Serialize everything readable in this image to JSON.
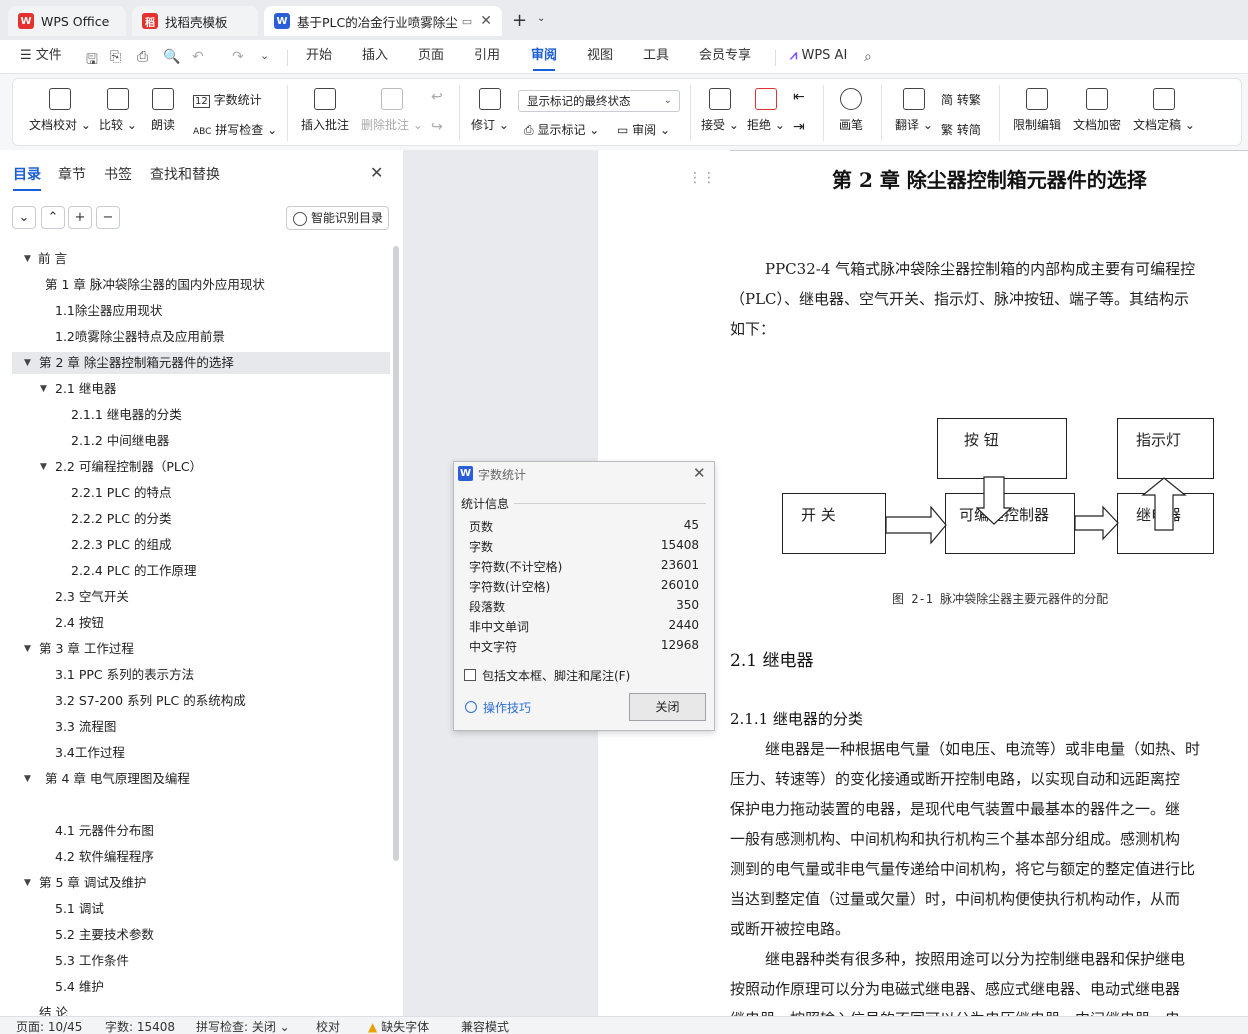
{
  "tabs": [
    {
      "label": "WPS Office"
    },
    {
      "label": "找稻壳模板"
    },
    {
      "label": "基于PLC的冶金行业喷雾除尘"
    }
  ],
  "menu": {
    "file": "文件",
    "items": [
      "开始",
      "插入",
      "页面",
      "引用",
      "审阅",
      "视图",
      "工具",
      "会员专享"
    ],
    "active": "审阅",
    "wps_ai": "WPS AI"
  },
  "ribbon": {
    "doc_check": "文档校对",
    "compare": "比较",
    "read_aloud": "朗读",
    "word_count": "字数统计",
    "spell_check": "拼写检查",
    "insert_comment": "插入批注",
    "delete_comment": "删除批注",
    "revise": "修订",
    "markup_select": "显示标记的最终状态",
    "show_markup": "显示标记",
    "review": "审阅",
    "accept": "接受",
    "reject": "拒绝",
    "pen": "画笔",
    "translate": "翻译",
    "to_traditional": "简 转繁",
    "to_simplified": "繁 转简",
    "restrict_edit": "限制编辑",
    "doc_encrypt": "文档加密",
    "doc_finalize": "文档定稿"
  },
  "sidebar": {
    "tabs": [
      "目录",
      "章节",
      "书签",
      "查找和替换"
    ],
    "ai_toc": "智能识别目录",
    "toc": [
      {
        "label": "前  言"
      },
      {
        "label": "第 1 章  脉冲袋除尘器的国内外应用现状"
      },
      {
        "label": "1.1除尘器应用现状"
      },
      {
        "label": "1.2喷雾除尘器特点及应用前景"
      },
      {
        "label": "第 2 章  除尘器控制箱元器件的选择"
      },
      {
        "label": "2.1  继电器"
      },
      {
        "label": "2.1.1  继电器的分类"
      },
      {
        "label": "2.1.2  中间继电器"
      },
      {
        "label": "2.2  可编程控制器（PLC）"
      },
      {
        "label": "2.2.1    PLC 的特点"
      },
      {
        "label": "2.2.2    PLC 的分类"
      },
      {
        "label": "2.2.3    PLC 的组成"
      },
      {
        "label": "2.2.4    PLC 的工作原理"
      },
      {
        "label": "2.3  空气开关"
      },
      {
        "label": "2.4  按钮"
      },
      {
        "label": "第 3 章  工作过程"
      },
      {
        "label": "3.1    PPC 系列的表示方法"
      },
      {
        "label": "3.2    S7-200 系列 PLC 的系统构成"
      },
      {
        "label": "3.3    流程图"
      },
      {
        "label": "3.4工作过程"
      },
      {
        "label": "第 4 章  电气原理图及编程"
      },
      {
        "label": "4.1 元器件分布图"
      },
      {
        "label": "4.2  软件编程程序"
      },
      {
        "label": "第 5 章  调试及维护"
      },
      {
        "label": "5.1  调试"
      },
      {
        "label": "5.2  主要技术参数"
      },
      {
        "label": "5.3  工作条件"
      },
      {
        "label": "5.4  维护"
      },
      {
        "label": "结  论"
      }
    ]
  },
  "dialog": {
    "title": "字数统计",
    "section": "统计信息",
    "stats": [
      {
        "label": "页数",
        "value": "45"
      },
      {
        "label": "字数",
        "value": "15408"
      },
      {
        "label": "字符数(不计空格)",
        "value": "23601"
      },
      {
        "label": "字符数(计空格)",
        "value": "26010"
      },
      {
        "label": "段落数",
        "value": "350"
      },
      {
        "label": "非中文单词",
        "value": "2440"
      },
      {
        "label": "中文字符",
        "value": "12968"
      }
    ],
    "include_label": "包括文本框、脚注和尾注(F)",
    "include_checked": false,
    "tips": "操作技巧",
    "close": "关闭"
  },
  "document": {
    "chapter_title": "第 2 章  除尘器控制箱元器件的选择",
    "intro_lines": [
      "PPC32-4 气箱式脉冲袋除尘器控制箱的内部构成主要有可编程控",
      "（PLC）、继电器、空气开关、指示灯、脉冲按钮、端子等。其结构示",
      "如下："
    ],
    "diagram": {
      "button": "按    钮",
      "indicator": "指示灯",
      "switch": "开  关",
      "plc": "可编程控制器",
      "relay": "继电器",
      "caption": "图 2-1  脉冲袋除尘器主要元器件的分配"
    },
    "section_21": "2.1  继电器",
    "section_211": "2.1.1  继电器的分类",
    "body_lines": [
      "继电器是一种根据电气量（如电压、电流等）或非电量（如热、时",
      "压力、转速等）的变化接通或断开控制电路，以实现自动和远距离控",
      "保护电力拖动装置的电器，是现代电气装置中最基本的器件之一。继",
      "一般有感测机构、中间机构和执行机构三个基本部分组成。感测机构",
      "测到的电气量或非电气量传递给中间机构，将它与额定的整定值进行比",
      "当达到整定值（过量或欠量）时，中间机构便使执行机构动作，从而",
      "或断开被控电路。",
      "继电器种类有很多种，按照用途可以分为控制继电器和保护继电",
      "按照动作原理可以分为电磁式继电器、感应式继电器、电动式继电器",
      "继电器，按照输入信号的不同可以分为电压继电器、中间继电器、电"
    ]
  },
  "status": {
    "page": "页面: 10/45",
    "words": "字数: 15408",
    "spell": "拼写检查: 关闭",
    "proof": "校对",
    "missing_font": "缺失字体",
    "compat": "兼容模式"
  },
  "colors": {
    "accent": "#1a5fd7",
    "wps_red": "#e5312e",
    "selected_bg": "#e6e8eb"
  }
}
